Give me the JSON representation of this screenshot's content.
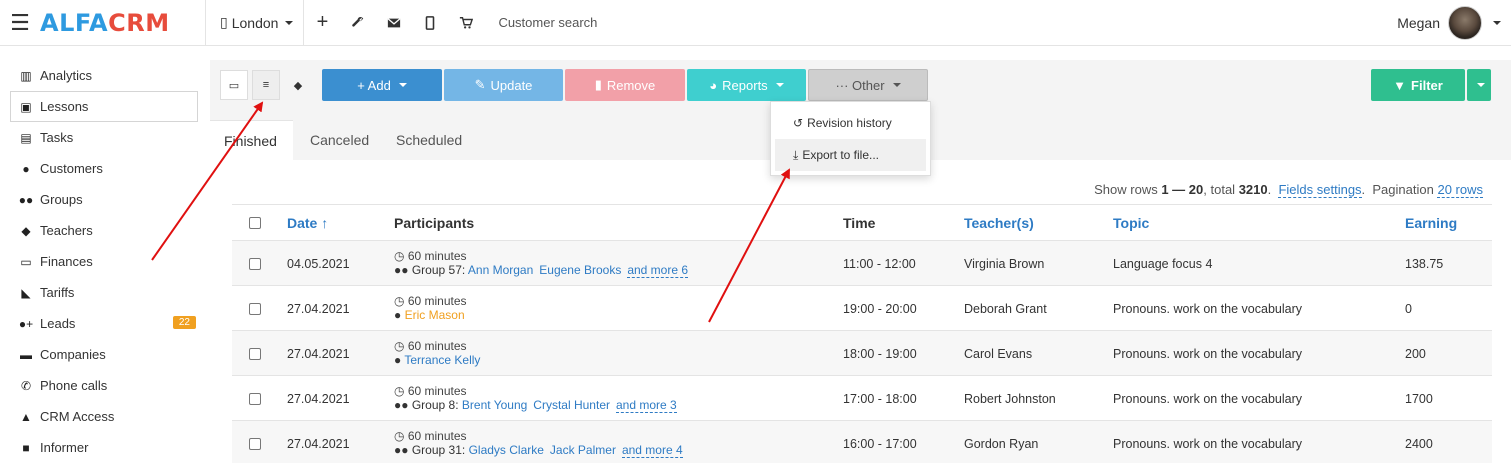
{
  "app": {
    "logo_part1": "ALFA",
    "logo_part2": "CRM",
    "branch": "London",
    "search_placeholder": "Customer search",
    "user_name": "Megan"
  },
  "sidebar": {
    "items": [
      {
        "label": "Analytics",
        "icon": "map-icon"
      },
      {
        "label": "Lessons",
        "icon": "calendar-icon"
      },
      {
        "label": "Tasks",
        "icon": "tasks-icon"
      },
      {
        "label": "Customers",
        "icon": "user-icon"
      },
      {
        "label": "Groups",
        "icon": "users-icon"
      },
      {
        "label": "Teachers",
        "icon": "graduation-cap-icon"
      },
      {
        "label": "Finances",
        "icon": "money-icon"
      },
      {
        "label": "Tariffs",
        "icon": "tag-icon"
      },
      {
        "label": "Leads",
        "icon": "user-plus-icon",
        "badge": "22"
      },
      {
        "label": "Companies",
        "icon": "briefcase-icon"
      },
      {
        "label": "Phone calls",
        "icon": "phone-icon"
      },
      {
        "label": "CRM Access",
        "icon": "lock-icon"
      },
      {
        "label": "Informer",
        "icon": "book-icon"
      }
    ]
  },
  "toolbar": {
    "add": "+ Add",
    "update": "Update",
    "remove": "Remove",
    "reports": "Reports",
    "other": "··· Other",
    "filter": "Filter"
  },
  "dropdown": {
    "revision_history": "Revision history",
    "export": "Export to file..."
  },
  "tabs": {
    "finished": "Finished",
    "canceled": "Canceled",
    "scheduled": "Scheduled"
  },
  "pager": {
    "prefix": "Show rows",
    "range": "1 — 20",
    "total_label": ", total",
    "total": "3210",
    "fields_settings": "Fields settings",
    "pagination_label": "Pagination",
    "pagination": "20 rows"
  },
  "table": {
    "headers": {
      "date": "Date ↑",
      "participants": "Participants",
      "time": "Time",
      "teacher": "Teacher(s)",
      "topic": "Topic",
      "earning": "Earning"
    },
    "rows": [
      {
        "date": "04.05.2021",
        "duration": "60 minutes",
        "group": "Group 57:",
        "p1": "Ann Morgan",
        "p2": "Eugene Brooks",
        "more": "and more 6",
        "time": "11:00 - 12:00",
        "teacher": "Virginia Brown",
        "topic": "Language focus 4",
        "earning": "138.75"
      },
      {
        "date": "27.04.2021",
        "duration": "60 minutes",
        "group": "",
        "p1": "Eric Mason",
        "p2": "",
        "more": "",
        "time": "19:00 - 20:00",
        "teacher": "Deborah Grant",
        "topic": "Pronouns. work on the vocabulary",
        "earning": "0"
      },
      {
        "date": "27.04.2021",
        "duration": "60 minutes",
        "group": "",
        "p1": "Terrance Kelly",
        "p2": "",
        "more": "",
        "time": "18:00 - 19:00",
        "teacher": "Carol Evans",
        "topic": "Pronouns. work on the vocabulary",
        "earning": "200"
      },
      {
        "date": "27.04.2021",
        "duration": "60 minutes",
        "group": "Group 8:",
        "p1": "Brent Young",
        "p2": "Crystal Hunter",
        "more": "and more 3",
        "time": "17:00 - 18:00",
        "teacher": "Robert Johnston",
        "topic": "Pronouns. work on the vocabulary",
        "earning": "1700"
      },
      {
        "date": "27.04.2021",
        "duration": "60 minutes",
        "group": "Group 31:",
        "p1": "Gladys Clarke",
        "p2": "Jack Palmer",
        "more": "and more 4",
        "time": "16:00 - 17:00",
        "teacher": "Gordon Ryan",
        "topic": "Pronouns. work on the vocabulary",
        "earning": "2400"
      }
    ]
  },
  "colors": {
    "add": "#3b8fd0",
    "update": "#74b6e6",
    "remove": "#f2a0a8",
    "reports": "#3fcfcf",
    "other": "#cfcfcf",
    "filter": "#2fbf8f",
    "arrow": "#e01010"
  }
}
